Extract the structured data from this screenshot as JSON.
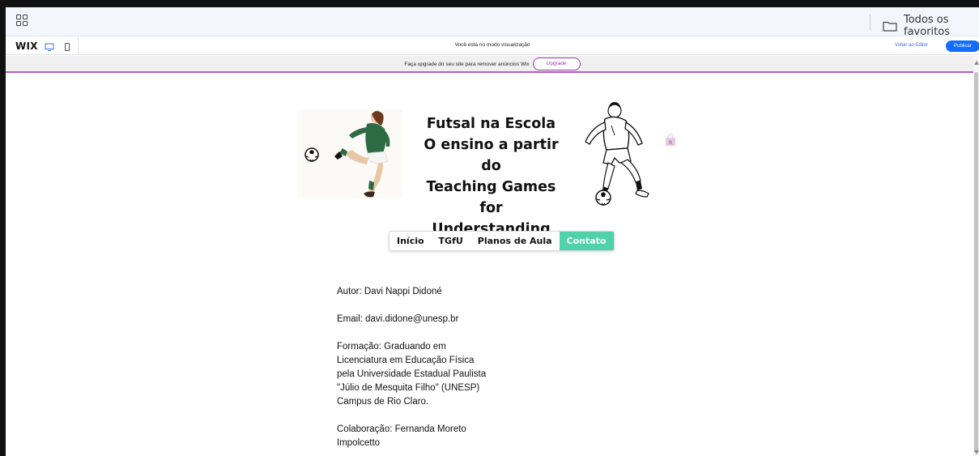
{
  "browser": {
    "bookmarks_folder_label": "Todos os favoritos"
  },
  "wix_bar": {
    "logo": "WIX",
    "preview_message": "Você está no modo visualização",
    "back_to_editor": "Voltar ao Editor",
    "publish": "Publicar"
  },
  "upgrade_banner": {
    "text": "Faça upgrade do seu site para remover anúncios Wix",
    "button": "Upgrade"
  },
  "site": {
    "title_lines": [
      "Futsal na Escola",
      "O ensino a partir do",
      "Teaching Games for",
      "Understanding"
    ],
    "cart_count": "0",
    "nav": [
      {
        "label": "Início",
        "active": false
      },
      {
        "label": "TGfU",
        "active": false
      },
      {
        "label": "Planos de Aula",
        "active": false
      },
      {
        "label": "Contato",
        "active": true
      }
    ],
    "accent_color": "#4fd1a9",
    "content": {
      "author": "Autor: Davi Nappi Didoné",
      "email": "Email: davi.didone@unesp.br",
      "formacao_lines": [
        "Formação: Graduando em",
        "Licenciatura em Educação Física",
        "pela Universidade Estadual Paulista",
        "\"Júlio de Mesquita Filho\" (UNESP)",
        "Campus de Rio Claro."
      ],
      "colaboracao_lines": [
        "Colaboração: Fernanda Moreto",
        "Impolcetto"
      ]
    }
  },
  "colors": {
    "upgrade_accent": "#9b3fb1",
    "publish_blue": "#116dff"
  }
}
